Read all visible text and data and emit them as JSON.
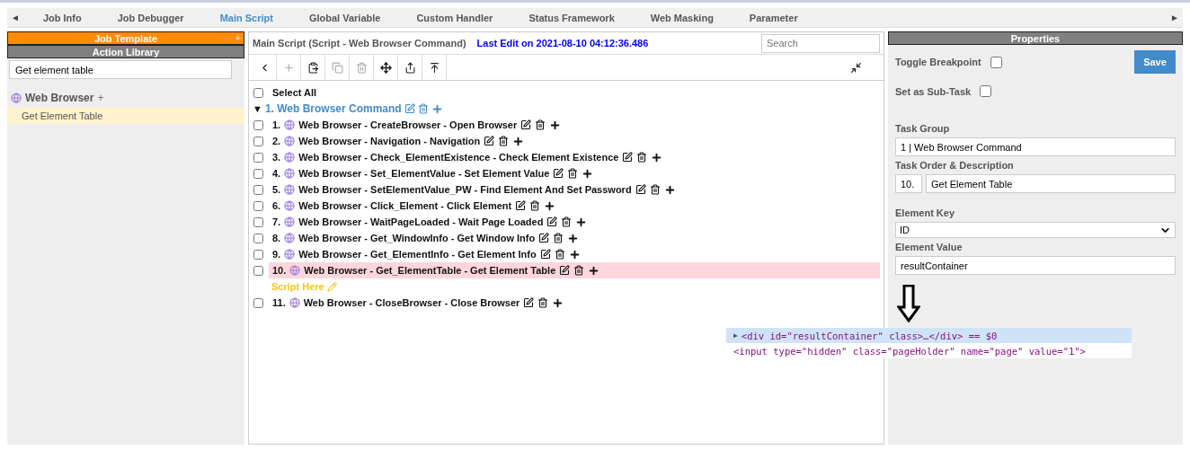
{
  "tab_bar": {
    "prev": "◄",
    "next": "►",
    "tabs": [
      {
        "label": "Job Info",
        "selected": false
      },
      {
        "label": "Job Debugger",
        "selected": false
      },
      {
        "label": "Main Script",
        "selected": true
      },
      {
        "label": "Global Variable",
        "selected": false
      },
      {
        "label": "Custom Handler",
        "selected": false
      },
      {
        "label": "Status Framework",
        "selected": false
      },
      {
        "label": "Web Masking",
        "selected": false
      },
      {
        "label": "Parameter",
        "selected": false
      }
    ]
  },
  "sidebar": {
    "job_template": {
      "title": "Job Template",
      "add": "+"
    },
    "action_library": {
      "title": "Action Library"
    },
    "search": {
      "value": "Get element table"
    },
    "items": [
      {
        "label": "Web Browser",
        "add": "+",
        "children": [
          {
            "label": "Get Element Table",
            "selected": true
          }
        ]
      }
    ]
  },
  "script": {
    "title": "Main Script (Script - Web Browser Command)",
    "last_edit": "Last Edit on 2021-08-10 04:12:36.486",
    "search": {
      "placeholder": "Search"
    },
    "toolbar": [
      {
        "kind": "back",
        "disabled": false
      },
      {
        "kind": "add",
        "disabled": true
      },
      {
        "kind": "paste",
        "disabled": false
      },
      {
        "kind": "copy",
        "disabled": true
      },
      {
        "kind": "delete",
        "disabled": true
      },
      {
        "kind": "move",
        "disabled": false
      },
      {
        "kind": "export",
        "disabled": false
      },
      {
        "kind": "top",
        "disabled": false
      }
    ],
    "select_all": {
      "label": "Select All",
      "checked": false
    },
    "group": {
      "caret": "▼",
      "label": "1. Web Browser Command"
    },
    "tasks": [
      {
        "kind": "task",
        "number": "1.",
        "text": "Web Browser - CreateBrowser - Open Browser",
        "checked": false,
        "selected": false
      },
      {
        "kind": "task",
        "number": "2.",
        "text": "Web Browser - Navigation - Navigation",
        "checked": false,
        "selected": false
      },
      {
        "kind": "task",
        "number": "3.",
        "text": "Web Browser - Check_ElementExistence - Check Element Existence",
        "checked": false,
        "selected": false
      },
      {
        "kind": "task",
        "number": "4.",
        "text": "Web Browser - Set_ElementValue - Set Element Value",
        "checked": false,
        "selected": false
      },
      {
        "kind": "task",
        "number": "5.",
        "text": "Web Browser - SetElementValue_PW - Find Element And Set Password",
        "checked": false,
        "selected": false
      },
      {
        "kind": "task",
        "number": "6.",
        "text": "Web Browser - Click_Element - Click Element",
        "checked": false,
        "selected": false
      },
      {
        "kind": "task",
        "number": "7.",
        "text": "Web Browser - WaitPageLoaded - Wait Page Loaded",
        "checked": false,
        "selected": false
      },
      {
        "kind": "task",
        "number": "8.",
        "text": "Web Browser - Get_WindowInfo - Get Window Info",
        "checked": false,
        "selected": false
      },
      {
        "kind": "task",
        "number": "9.",
        "text": "Web Browser - Get_ElementInfo - Get Element Info",
        "checked": false,
        "selected": false
      },
      {
        "kind": "task",
        "number": "10.",
        "text": "Web Browser - Get_ElementTable - Get Element Table",
        "checked": false,
        "selected": true
      },
      {
        "kind": "marker",
        "text": "Script Here"
      },
      {
        "kind": "task",
        "number": "11.",
        "text": "Web Browser - CloseBrowser - Close Browser",
        "checked": false,
        "selected": false
      }
    ]
  },
  "devtools_snippet": {
    "lines": [
      {
        "expander": "▶",
        "text": "<div id=\"resultContainer\" class>…</div> == $0",
        "selected": true
      },
      {
        "text": "<input type=\"hidden\" class=\"pageHolder\" name=\"page\" value=\"1\">",
        "selected": false
      }
    ]
  },
  "properties": {
    "title": "Properties",
    "toggle_breakpoint": {
      "label": "Toggle Breakpoint",
      "checked": false
    },
    "save": "Save",
    "sub_task": {
      "label": "Set as Sub-Task",
      "checked": false
    },
    "task_group": {
      "label": "Task Group",
      "value": "1 | Web Browser Command"
    },
    "task_order": {
      "label": "Task Order & Description",
      "order": "10.",
      "description": "Get Element Table"
    },
    "element_key": {
      "label": "Element Key",
      "value": "ID"
    },
    "element_value": {
      "label": "Element Value",
      "value": "resultContainer"
    }
  }
}
